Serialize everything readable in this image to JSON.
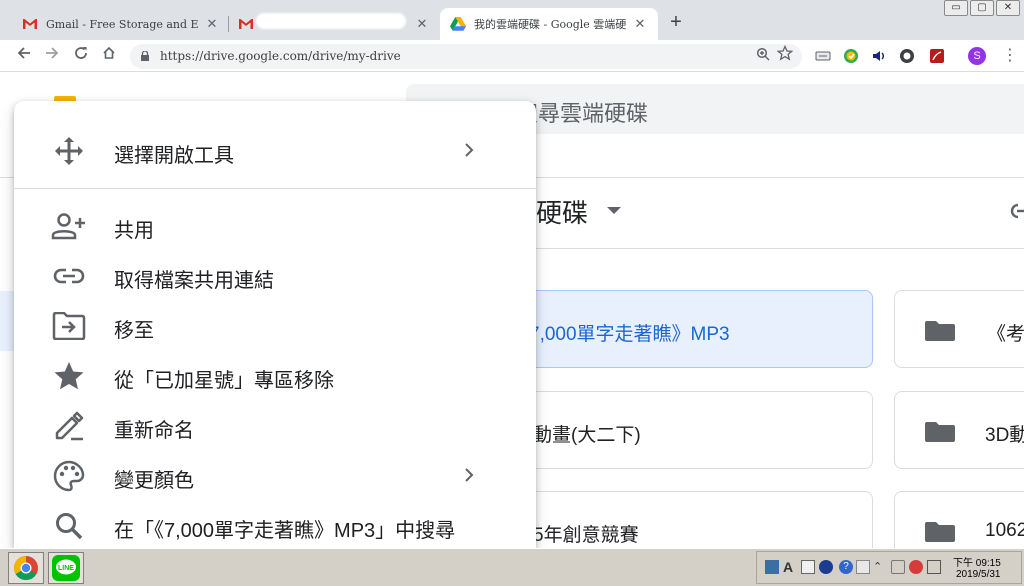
{
  "browser": {
    "tabs": [
      {
        "title": "Gmail - Free Storage and Email from",
        "close": "✕"
      },
      {
        "title": "",
        "close": "✕"
      },
      {
        "title": "我的雲端硬碟 - Google 雲端硬碟",
        "close": "✕"
      }
    ],
    "new_tab": "+",
    "address": {
      "url": "https://drive.google.com/drive/my-drive"
    },
    "profile_initial": "S",
    "window_controls": [
      "▭",
      "▢",
      "✕"
    ]
  },
  "drive": {
    "search_placeholder": "搜尋雲端硬碟",
    "my_drive_title": "硬碟",
    "quick_access": [
      {
        "name": "7,000單字走著瞧》MP3"
      },
      {
        "name": "《考"
      },
      {
        "name": "動畫(大二下)"
      },
      {
        "name": "3D動"
      },
      {
        "name": "5年創意競賽"
      },
      {
        "name": "1062"
      }
    ]
  },
  "context_menu": {
    "items": [
      {
        "label": "選擇開啟工具",
        "icon": "open-with-icon",
        "submenu": true
      },
      {
        "label": "共用",
        "icon": "add-person-icon",
        "submenu": false
      },
      {
        "label": "取得檔案共用連結",
        "icon": "link-icon",
        "submenu": false
      },
      {
        "label": "移至",
        "icon": "move-to-folder-icon",
        "submenu": false
      },
      {
        "label": "從「已加星號」專區移除",
        "icon": "star-icon",
        "submenu": false
      },
      {
        "label": "重新命名",
        "icon": "pencil-icon",
        "submenu": false
      },
      {
        "label": "變更顏色",
        "icon": "palette-icon",
        "submenu": true
      },
      {
        "label": "在「《7,000單字走著瞧》MP3」中搜尋",
        "icon": "search-icon",
        "submenu": false
      }
    ]
  },
  "taskbar": {
    "clock_time": "下午 09:15",
    "clock_date": "2019/5/31",
    "line_label": "LINE"
  },
  "colors": {
    "accent_blue": "#1967d2",
    "selected_bg": "#e8f0fe",
    "icon_gray": "#5f6368"
  }
}
